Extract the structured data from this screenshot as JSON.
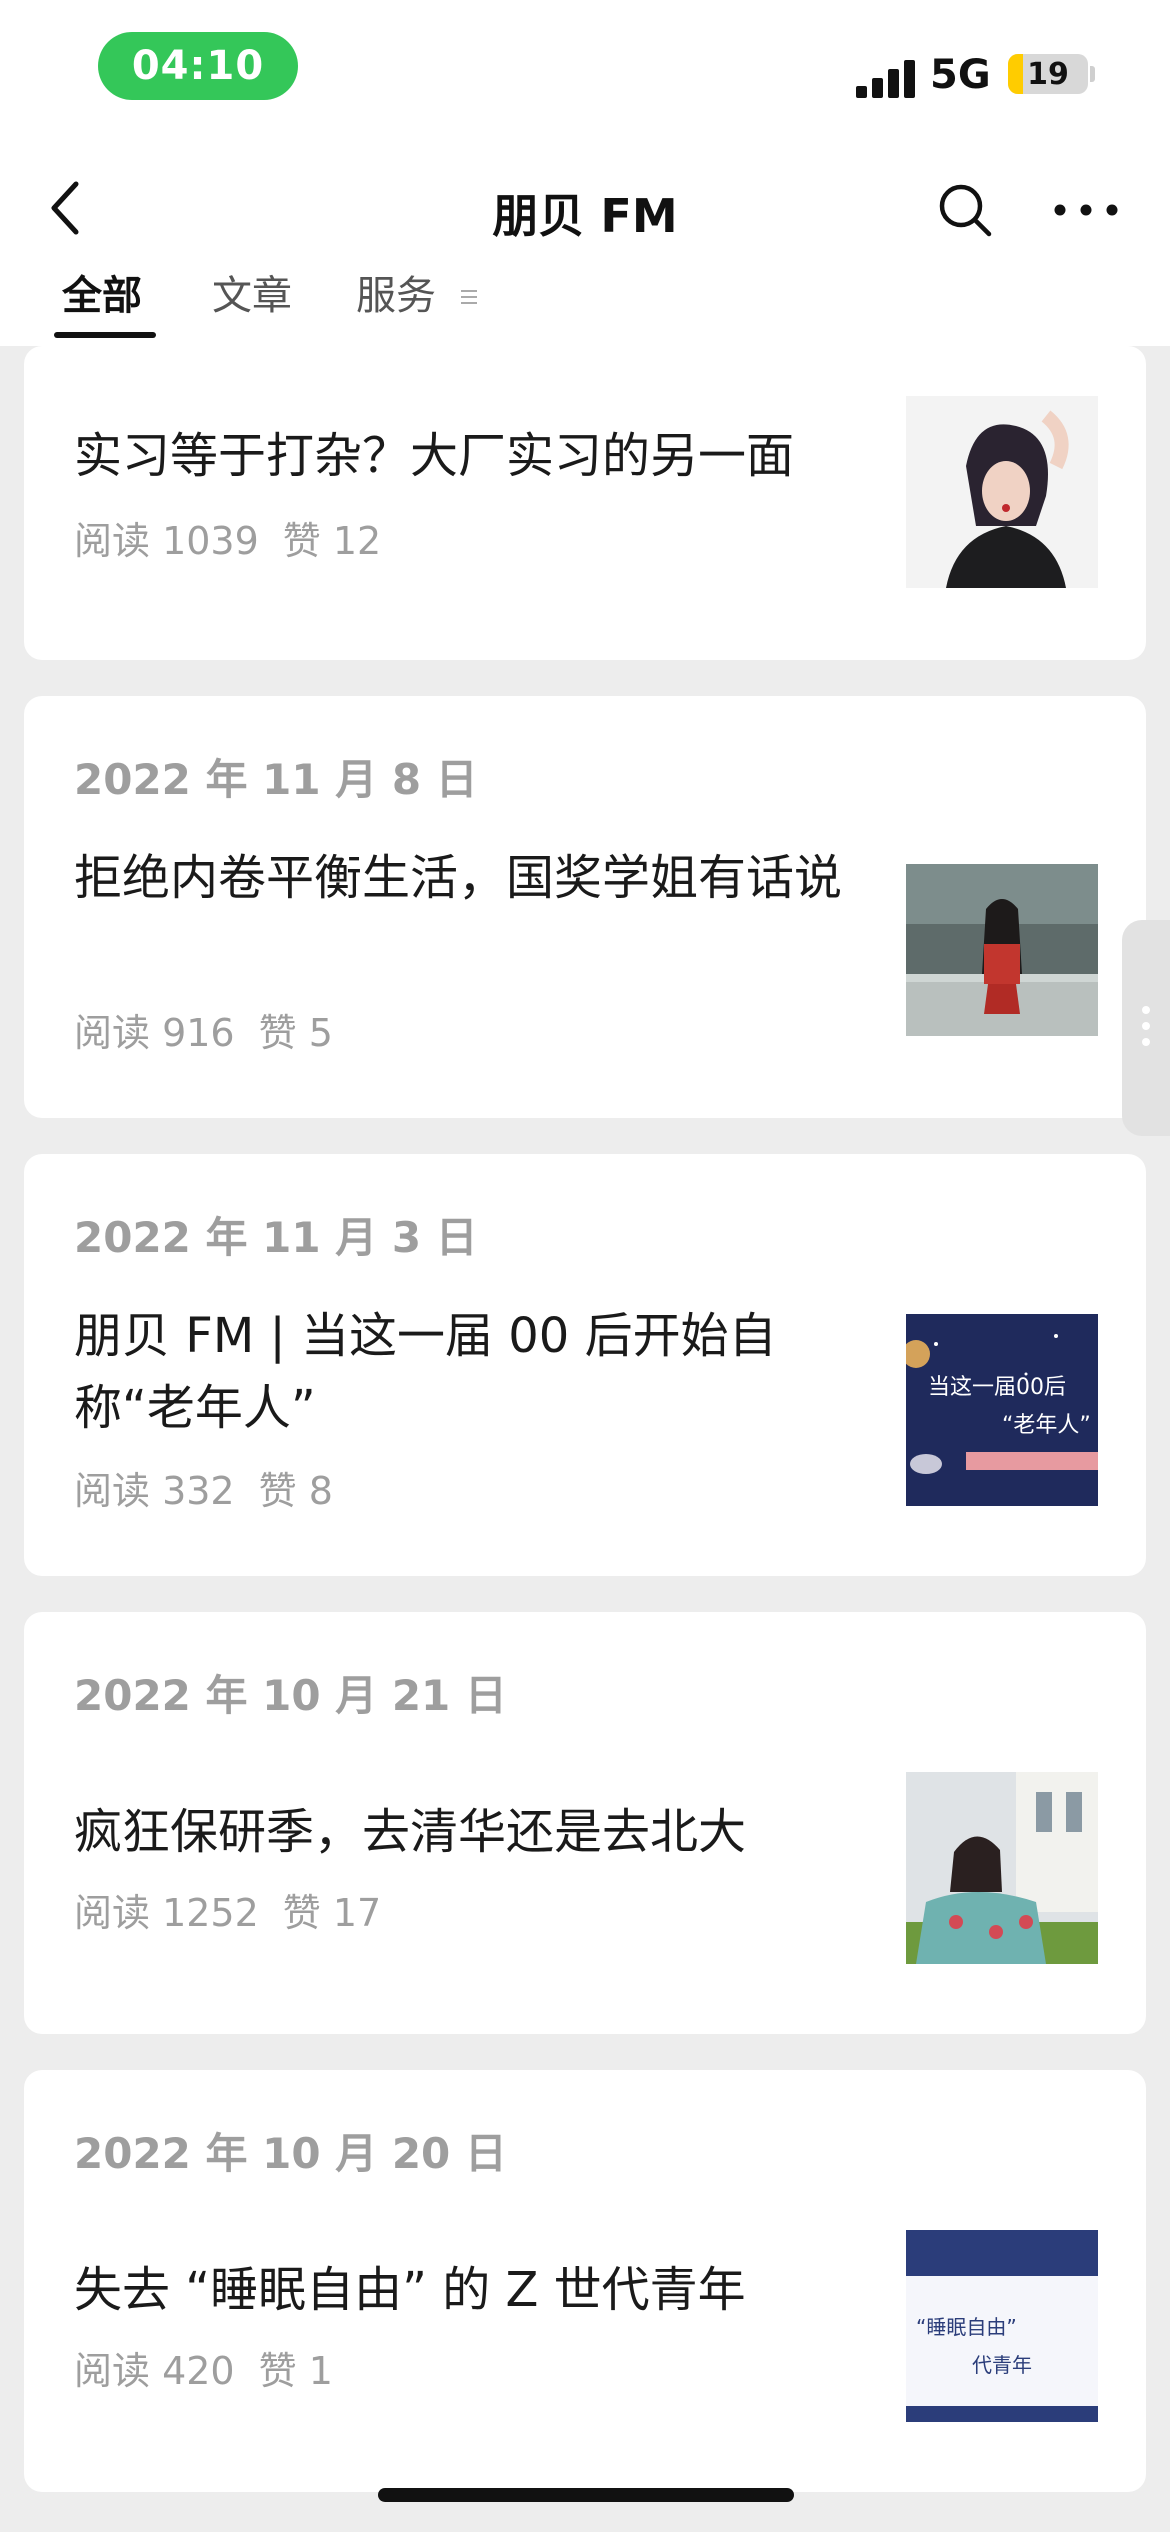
{
  "status_bar": {
    "time": "04:10",
    "network": "5G",
    "battery": "19",
    "battery_level": 0.19
  },
  "header": {
    "title": "朋贝 FM"
  },
  "tabs": [
    {
      "label": "全部"
    },
    {
      "label": "文章"
    },
    {
      "label": "服务"
    }
  ],
  "articles": [
    {
      "date": "",
      "title": "实习等于打杂？大厂实习的另一面",
      "reads": "阅读 1039",
      "likes": "赞 12"
    },
    {
      "date": "2022 年 11 月 8 日",
      "title": "拒绝内卷平衡生活，国奖学姐有话说",
      "reads": "阅读 916",
      "likes": "赞 5"
    },
    {
      "date": "2022 年 11 月 3 日",
      "title": "朋贝 FM | 当这一届 00 后开始自称“老年人”",
      "reads": "阅读 332",
      "likes": "赞 8",
      "thumb_text": [
        "当这一届00后",
        "“老年人”"
      ]
    },
    {
      "date": "2022 年 10 月 21 日",
      "title": "疯狂保研季，去清华还是去北大",
      "reads": "阅读 1252",
      "likes": "赞 17"
    },
    {
      "date": "2022 年 10 月 20 日",
      "title": "失去 “睡眠自由” 的 Z 世代青年",
      "reads": "阅读 420",
      "likes": "赞 1",
      "thumb_text": [
        "“睡眠自由”",
        "代青年"
      ]
    }
  ]
}
